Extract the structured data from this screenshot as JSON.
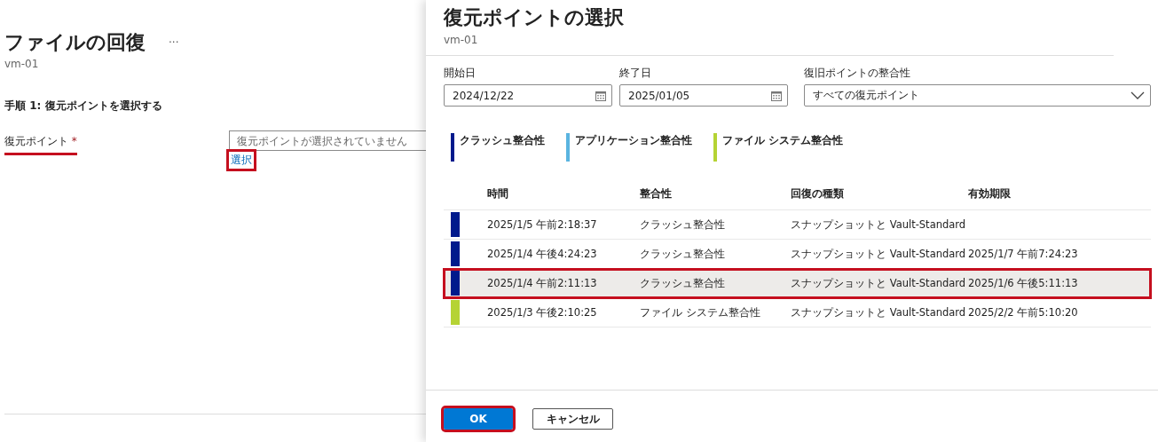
{
  "page": {
    "title": "ファイルの回復",
    "more": "···",
    "subtitle": "vm-01",
    "step_heading": "手順 1: 復元ポイントを選択する",
    "field": {
      "label": "復元ポイント",
      "required": "*",
      "highlighted": true,
      "placeholder": "復元ポイントが選択されていません"
    },
    "select_link": {
      "label": "選択",
      "highlighted": true
    }
  },
  "panel": {
    "title": "復元ポイントの選択",
    "subtitle": "vm-01",
    "filters": [
      {
        "kind": "date",
        "label": "開始日",
        "value": "2024/12/22"
      },
      {
        "kind": "date",
        "label": "終了日",
        "value": "2025/01/05"
      },
      {
        "kind": "dropdown",
        "label": "復旧ポイントの整合性",
        "value": "すべての復元ポイント"
      }
    ],
    "legend": [
      {
        "label": "クラッシュ整合性",
        "color": "#001a8c"
      },
      {
        "label": "アプリケーション整合性",
        "color": "#5ab4e0"
      },
      {
        "label": "ファイル システム整合性",
        "color": "#b5d334"
      }
    ],
    "table": {
      "columns": [
        "時間",
        "整合性",
        "回復の種類",
        "有効期限"
      ],
      "rows": [
        {
          "color": "#001a8c",
          "selected": false,
          "cells": [
            "2025/1/5 午前2:18:37",
            "クラッシュ整合性",
            "スナップショットと Vault-Standard",
            ""
          ]
        },
        {
          "color": "#001a8c",
          "selected": false,
          "cells": [
            "2025/1/4 午後4:24:23",
            "クラッシュ整合性",
            "スナップショットと Vault-Standard",
            "2025/1/7 午前7:24:23"
          ]
        },
        {
          "color": "#001a8c",
          "selected": true,
          "cells": [
            "2025/1/4 午前2:11:13",
            "クラッシュ整合性",
            "スナップショットと Vault-Standard",
            "2025/1/6 午後5:11:13"
          ]
        },
        {
          "color": "#b5d334",
          "selected": false,
          "cells": [
            "2025/1/3 午後2:10:25",
            "ファイル システム整合性",
            "スナップショットと Vault-Standard",
            "2025/2/2 午前5:10:20"
          ]
        }
      ]
    },
    "buttons": [
      {
        "kind": "primary",
        "label": "OK",
        "highlighted": true
      },
      {
        "kind": "secondary",
        "label": "キャンセル",
        "highlighted": false
      }
    ]
  }
}
